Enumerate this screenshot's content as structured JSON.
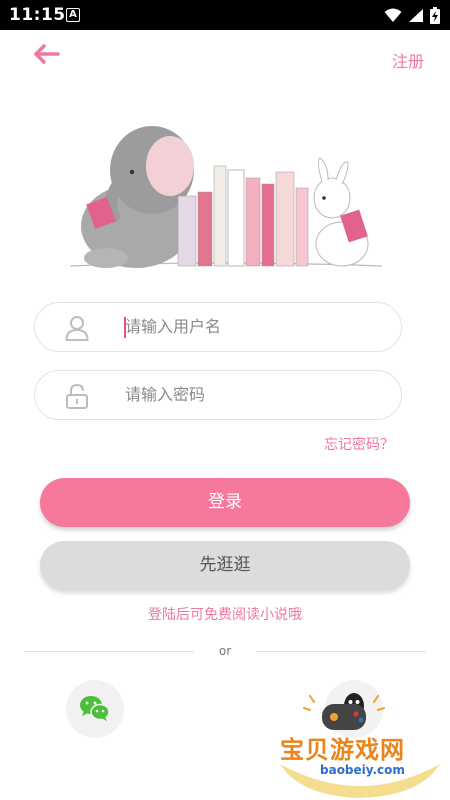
{
  "status_bar": {
    "time": "11:15",
    "notification_badge": "A",
    "icons": [
      "wifi-icon",
      "signal-icon",
      "battery-charging-icon"
    ]
  },
  "header": {
    "back_icon": "arrow-left-icon",
    "register_label": "注册"
  },
  "illustration": {
    "description_icon": "elephant-rabbit-books-illustration"
  },
  "login_form": {
    "username_placeholder": "请输入用户名",
    "password_placeholder": "请输入密码",
    "forgot_password": "忘记密码？",
    "login_label": "登录",
    "browse_label": "先逛逛",
    "hint": "登陆后可免费阅读小说哦"
  },
  "divider": {
    "text": "or"
  },
  "social_login": [
    {
      "icon": "wechat-icon"
    },
    {
      "icon": "qq-icon"
    }
  ],
  "watermark": {
    "title": "宝贝游戏网",
    "url": "baobeiy.com"
  },
  "colors": {
    "accent": "#f6789b",
    "link": "#f0789c",
    "secondary_button": "#dcdcdc"
  }
}
